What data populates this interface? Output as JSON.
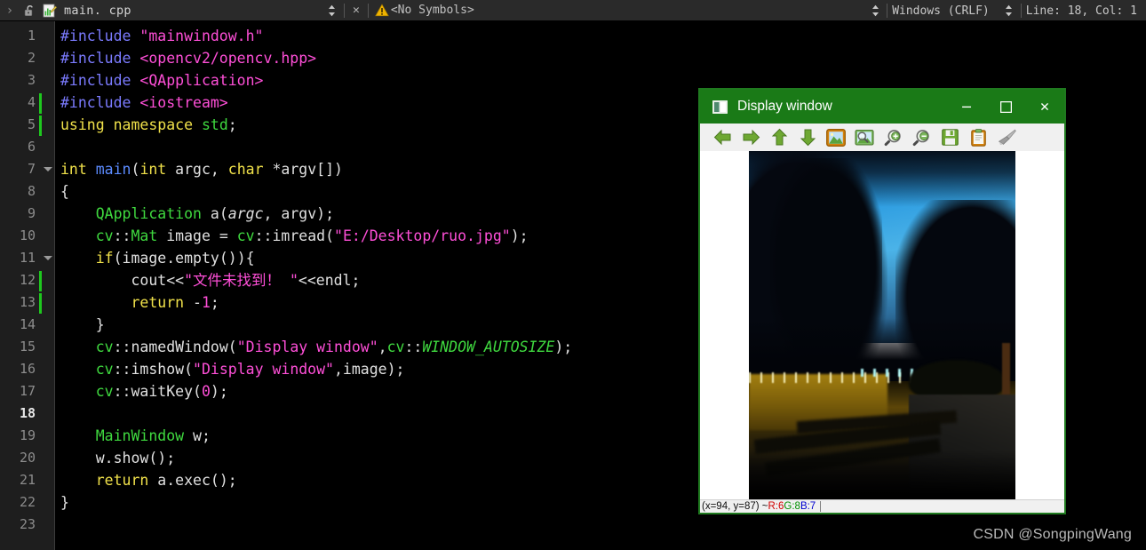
{
  "topbar": {
    "chevron": "›",
    "lock_icon": "open-padlock-icon",
    "file_icon": "cpp-file-icon",
    "filename": "main. cpp",
    "updown_glyph": "⬍",
    "close_glyph": "✕",
    "warning_icon": "warning-triangle-icon",
    "symbols_label": "<No Symbols>",
    "line_ending": "Windows (CRLF)",
    "cursor_position": "Line: 18, Col: 1"
  },
  "editor": {
    "lines": [
      {
        "n": "1",
        "change": false,
        "fold": false,
        "current": false,
        "tokens": [
          {
            "t": "#include ",
            "c": "t-pre"
          },
          {
            "t": "\"mainwindow.h\"",
            "c": "t-str"
          }
        ]
      },
      {
        "n": "2",
        "change": false,
        "fold": false,
        "current": false,
        "tokens": [
          {
            "t": "#include ",
            "c": "t-pre"
          },
          {
            "t": "<opencv2/opencv.hpp>",
            "c": "t-str"
          }
        ]
      },
      {
        "n": "3",
        "change": false,
        "fold": false,
        "current": false,
        "tokens": [
          {
            "t": "#include ",
            "c": "t-pre"
          },
          {
            "t": "<QApplication>",
            "c": "t-str"
          }
        ]
      },
      {
        "n": "4",
        "change": true,
        "fold": false,
        "current": false,
        "tokens": [
          {
            "t": "#include ",
            "c": "t-pre"
          },
          {
            "t": "<iostream>",
            "c": "t-str"
          }
        ]
      },
      {
        "n": "5",
        "change": true,
        "fold": false,
        "current": false,
        "tokens": [
          {
            "t": "using",
            "c": "t-kw"
          },
          {
            "t": " ",
            "c": "t-plain"
          },
          {
            "t": "namespace",
            "c": "t-kw"
          },
          {
            "t": " ",
            "c": "t-plain"
          },
          {
            "t": "std",
            "c": "t-cls"
          },
          {
            "t": ";",
            "c": "t-plain"
          }
        ]
      },
      {
        "n": "6",
        "change": false,
        "fold": false,
        "current": false,
        "tokens": []
      },
      {
        "n": "7",
        "change": false,
        "fold": true,
        "current": false,
        "tokens": [
          {
            "t": "int",
            "c": "t-kw"
          },
          {
            "t": " ",
            "c": "t-plain"
          },
          {
            "t": "main",
            "c": "t-fn"
          },
          {
            "t": "(",
            "c": "t-plain"
          },
          {
            "t": "int",
            "c": "t-kw"
          },
          {
            "t": " argc, ",
            "c": "t-plain"
          },
          {
            "t": "char",
            "c": "t-kw"
          },
          {
            "t": " *argv[])",
            "c": "t-plain"
          }
        ]
      },
      {
        "n": "8",
        "change": false,
        "fold": false,
        "current": false,
        "tokens": [
          {
            "t": "{",
            "c": "t-plain"
          }
        ]
      },
      {
        "n": "9",
        "change": false,
        "fold": false,
        "current": false,
        "tokens": [
          {
            "t": "    ",
            "c": "t-plain"
          },
          {
            "t": "QApplication",
            "c": "t-cls"
          },
          {
            "t": " a(",
            "c": "t-plain"
          },
          {
            "t": "argc",
            "c": "t-param"
          },
          {
            "t": ", argv);",
            "c": "t-plain"
          }
        ]
      },
      {
        "n": "10",
        "change": false,
        "fold": false,
        "current": false,
        "tokens": [
          {
            "t": "    ",
            "c": "t-plain"
          },
          {
            "t": "cv",
            "c": "t-cls"
          },
          {
            "t": "::",
            "c": "t-plain"
          },
          {
            "t": "Mat",
            "c": "t-cls"
          },
          {
            "t": " image = ",
            "c": "t-plain"
          },
          {
            "t": "cv",
            "c": "t-cls"
          },
          {
            "t": "::",
            "c": "t-plain"
          },
          {
            "t": "imread",
            "c": "t-plain"
          },
          {
            "t": "(",
            "c": "t-plain"
          },
          {
            "t": "\"E:/Desktop/ruo.jpg\"",
            "c": "t-str"
          },
          {
            "t": ");",
            "c": "t-plain"
          }
        ]
      },
      {
        "n": "11",
        "change": false,
        "fold": true,
        "current": false,
        "tokens": [
          {
            "t": "    ",
            "c": "t-plain"
          },
          {
            "t": "if",
            "c": "t-kw"
          },
          {
            "t": "(image.empty()){",
            "c": "t-plain"
          }
        ]
      },
      {
        "n": "12",
        "change": true,
        "fold": false,
        "current": false,
        "tokens": [
          {
            "t": "        cout<<",
            "c": "t-plain"
          },
          {
            "t": "\"文件未找到！ \"",
            "c": "t-str"
          },
          {
            "t": "<<endl;",
            "c": "t-plain"
          }
        ]
      },
      {
        "n": "13",
        "change": true,
        "fold": false,
        "current": false,
        "tokens": [
          {
            "t": "        ",
            "c": "t-plain"
          },
          {
            "t": "return",
            "c": "t-kw"
          },
          {
            "t": " -",
            "c": "t-plain"
          },
          {
            "t": "1",
            "c": "t-num"
          },
          {
            "t": ";",
            "c": "t-plain"
          }
        ]
      },
      {
        "n": "14",
        "change": false,
        "fold": false,
        "current": false,
        "tokens": [
          {
            "t": "    }",
            "c": "t-plain"
          }
        ]
      },
      {
        "n": "15",
        "change": false,
        "fold": false,
        "current": false,
        "tokens": [
          {
            "t": "    ",
            "c": "t-plain"
          },
          {
            "t": "cv",
            "c": "t-cls"
          },
          {
            "t": "::",
            "c": "t-plain"
          },
          {
            "t": "namedWindow",
            "c": "t-plain"
          },
          {
            "t": "(",
            "c": "t-plain"
          },
          {
            "t": "\"Display window\"",
            "c": "t-str"
          },
          {
            "t": ",",
            "c": "t-plain"
          },
          {
            "t": "cv",
            "c": "t-cls"
          },
          {
            "t": "::",
            "c": "t-plain"
          },
          {
            "t": "WINDOW_AUTOSIZE",
            "c": "t-italic"
          },
          {
            "t": ");",
            "c": "t-plain"
          }
        ]
      },
      {
        "n": "16",
        "change": false,
        "fold": false,
        "current": false,
        "tokens": [
          {
            "t": "    ",
            "c": "t-plain"
          },
          {
            "t": "cv",
            "c": "t-cls"
          },
          {
            "t": "::",
            "c": "t-plain"
          },
          {
            "t": "imshow",
            "c": "t-plain"
          },
          {
            "t": "(",
            "c": "t-plain"
          },
          {
            "t": "\"Display window\"",
            "c": "t-str"
          },
          {
            "t": ",image);",
            "c": "t-plain"
          }
        ]
      },
      {
        "n": "17",
        "change": false,
        "fold": false,
        "current": false,
        "tokens": [
          {
            "t": "    ",
            "c": "t-plain"
          },
          {
            "t": "cv",
            "c": "t-cls"
          },
          {
            "t": "::",
            "c": "t-plain"
          },
          {
            "t": "waitKey",
            "c": "t-plain"
          },
          {
            "t": "(",
            "c": "t-plain"
          },
          {
            "t": "0",
            "c": "t-num"
          },
          {
            "t": ");",
            "c": "t-plain"
          }
        ]
      },
      {
        "n": "18",
        "change": false,
        "fold": false,
        "current": true,
        "tokens": []
      },
      {
        "n": "19",
        "change": false,
        "fold": false,
        "current": false,
        "tokens": [
          {
            "t": "    ",
            "c": "t-plain"
          },
          {
            "t": "MainWindow",
            "c": "t-cls"
          },
          {
            "t": " w;",
            "c": "t-plain"
          }
        ]
      },
      {
        "n": "20",
        "change": false,
        "fold": false,
        "current": false,
        "tokens": [
          {
            "t": "    w.show();",
            "c": "t-plain"
          }
        ]
      },
      {
        "n": "21",
        "change": false,
        "fold": false,
        "current": false,
        "tokens": [
          {
            "t": "    ",
            "c": "t-plain"
          },
          {
            "t": "return",
            "c": "t-kw"
          },
          {
            "t": " a.exec();",
            "c": "t-plain"
          }
        ]
      },
      {
        "n": "22",
        "change": false,
        "fold": false,
        "current": false,
        "tokens": [
          {
            "t": "}",
            "c": "t-plain"
          }
        ]
      },
      {
        "n": "23",
        "change": false,
        "fold": false,
        "current": false,
        "tokens": []
      }
    ]
  },
  "display_window": {
    "title": "Display window",
    "title_icon": "window-image-icon",
    "minimize_glyph": "─",
    "maximize_glyph": "☐",
    "close_glyph": "✕",
    "titlebar_color": "#1a7a17",
    "toolbar": [
      {
        "name": "pan-left-icon",
        "label": "Pan left"
      },
      {
        "name": "pan-right-icon",
        "label": "Pan right"
      },
      {
        "name": "pan-up-icon",
        "label": "Pan up"
      },
      {
        "name": "pan-down-icon",
        "label": "Pan down"
      },
      {
        "name": "fit-image-icon",
        "label": "Fit image to window"
      },
      {
        "name": "zoom-fit-icon",
        "label": "Original size"
      },
      {
        "name": "zoom-in-icon",
        "label": "Zoom in"
      },
      {
        "name": "zoom-out-icon",
        "label": "Zoom out"
      },
      {
        "name": "save-icon",
        "label": "Save image"
      },
      {
        "name": "copy-icon",
        "label": "Copy to clipboard"
      },
      {
        "name": "brush-icon",
        "label": "Properties"
      }
    ],
    "status": {
      "coords": "(x=94, y=87) ~ ",
      "r": "R:6",
      "g": "G:8",
      "b": "B:7",
      "sep1": " ",
      "sep2": " "
    }
  },
  "watermark": "CSDN @SongpingWang"
}
